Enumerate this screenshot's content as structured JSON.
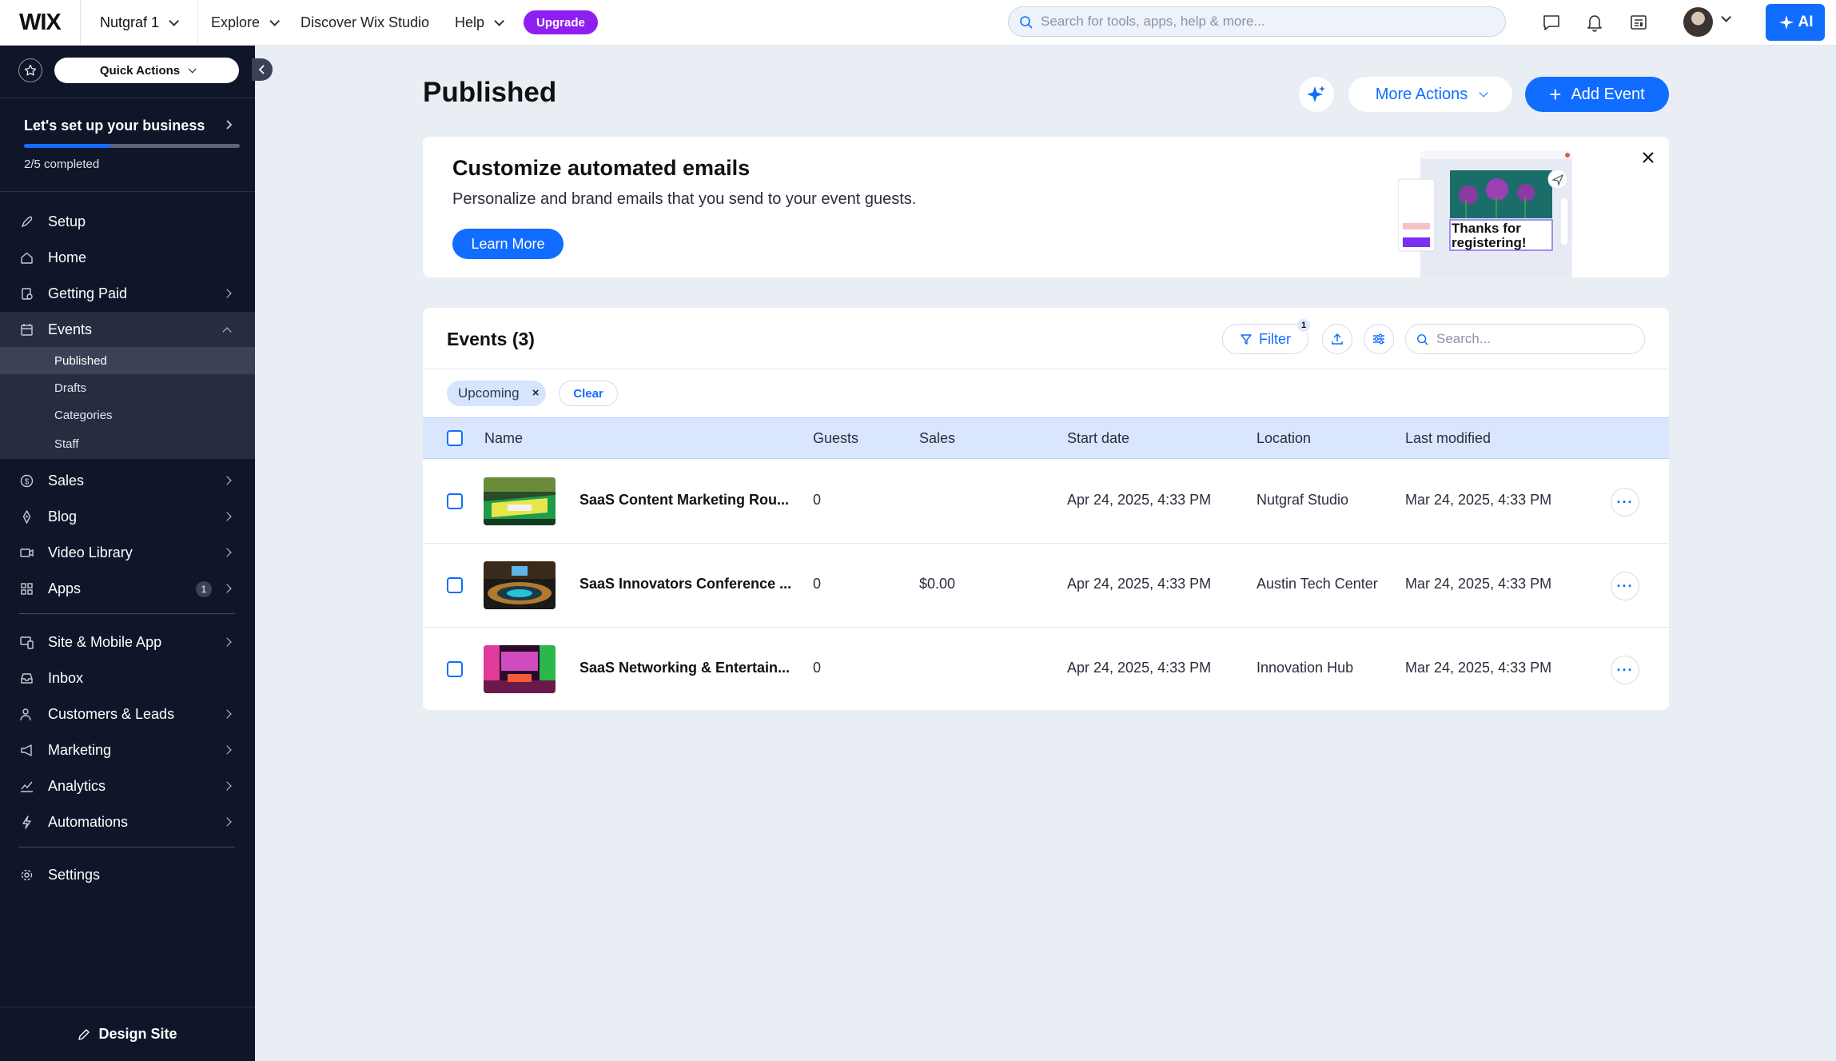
{
  "topbar": {
    "logo": "WIX",
    "site_name": "Nutgraf 1",
    "nav": [
      {
        "label": "Explore"
      },
      {
        "label": "Discover Wix Studio"
      },
      {
        "label": "Help"
      }
    ],
    "upgrade_label": "Upgrade",
    "search_placeholder": "Search for tools, apps, help & more...",
    "ai_label": "AI",
    "icons": [
      "chat-icon",
      "bell-icon",
      "news-icon"
    ]
  },
  "sidebar": {
    "quick_actions": "Quick Actions",
    "setup_title": "Let's set up your business",
    "setup_progress": "2/5 completed",
    "setup_fraction": 0.4,
    "items": [
      {
        "label": "Setup",
        "icon": "rocket-icon"
      },
      {
        "label": "Home",
        "icon": "home-icon"
      },
      {
        "label": "Getting Paid",
        "icon": "payment-icon"
      },
      {
        "label": "Events",
        "icon": "calendar-icon"
      },
      {
        "label": "Sales",
        "icon": "dollar-icon"
      },
      {
        "label": "Blog",
        "icon": "pen-nib-icon"
      },
      {
        "label": "Video Library",
        "icon": "video-icon"
      },
      {
        "label": "Apps",
        "icon": "apps-icon",
        "badge": "1"
      },
      {
        "label": "Site & Mobile App",
        "icon": "devices-icon"
      },
      {
        "label": "Inbox",
        "icon": "inbox-icon"
      },
      {
        "label": "Customers & Leads",
        "icon": "people-icon"
      },
      {
        "label": "Marketing",
        "icon": "megaphone-icon"
      },
      {
        "label": "Analytics",
        "icon": "chart-icon"
      },
      {
        "label": "Automations",
        "icon": "lightning-icon"
      },
      {
        "label": "Settings",
        "icon": "gear-icon"
      }
    ],
    "event_subitems": [
      {
        "label": "Published"
      },
      {
        "label": "Drafts"
      },
      {
        "label": "Categories"
      },
      {
        "label": "Staff"
      }
    ],
    "design_site": "Design Site"
  },
  "main": {
    "title": "Published",
    "more_actions": "More Actions",
    "add_event": "Add Event"
  },
  "banner": {
    "title": "Customize automated emails",
    "text": "Personalize and brand emails that you send to your event guests.",
    "button": "Learn More",
    "art_text": "Thanks for registering!"
  },
  "events": {
    "title": "Events (3)",
    "filter_label": "Filter",
    "filter_count": "1",
    "search_placeholder": "Search...",
    "chip": "Upcoming",
    "clear": "Clear",
    "columns": [
      "Name",
      "Guests",
      "Sales",
      "Start date",
      "Location",
      "Last modified"
    ],
    "rows": [
      {
        "name": "SaaS Content Marketing Rou...",
        "guests": "0",
        "sales": "",
        "start": "Apr 24, 2025, 4:33 PM",
        "location": "Nutgraf Studio",
        "modified": "Mar 24, 2025, 4:33 PM",
        "thumb": "green-lounge"
      },
      {
        "name": "SaaS Innovators Conference ...",
        "guests": "0",
        "sales": "$0.00",
        "start": "Apr 24, 2025, 4:33 PM",
        "location": "Austin Tech Center",
        "modified": "Mar 24, 2025, 4:33 PM",
        "thumb": "auditorium"
      },
      {
        "name": "SaaS Networking & Entertain...",
        "guests": "0",
        "sales": "",
        "start": "Apr 24, 2025, 4:33 PM",
        "location": "Innovation Hub",
        "modified": "Mar 24, 2025, 4:33 PM",
        "thumb": "neon-club"
      }
    ],
    "row_menu": "···"
  },
  "colors": {
    "accent": "#116dff",
    "sidebar_bg": "#0f1629",
    "upgrade": "#8e1ff0",
    "page_bg": "#e9edf4"
  }
}
